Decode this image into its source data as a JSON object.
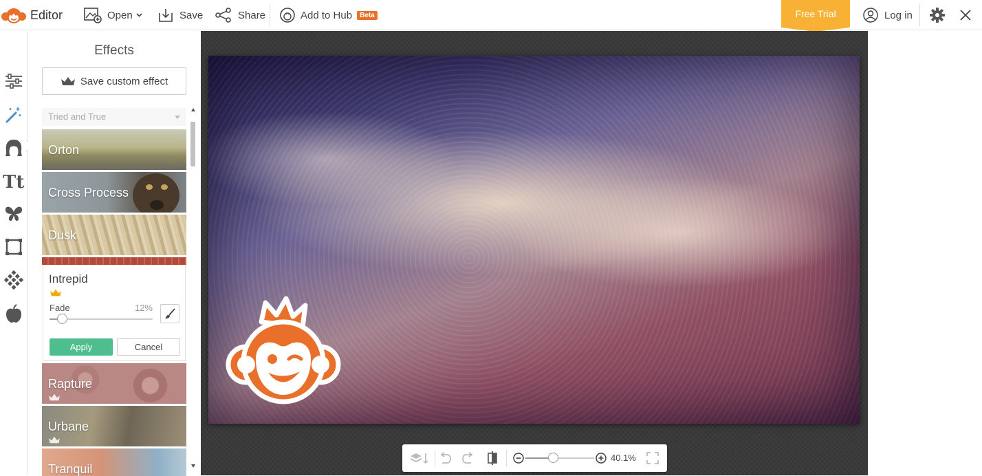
{
  "app": {
    "name": "Editor"
  },
  "colors": {
    "accent": "#e8702a",
    "apply": "#4fbe8e",
    "free_trial": "#f8b135"
  },
  "topbar": {
    "open_label": "Open",
    "save_label": "Save",
    "share_label": "Share",
    "hub_label": "Add to Hub",
    "beta_badge": "Beta",
    "free_trial_label": "Free Trial",
    "login_label": "Log in"
  },
  "rail": {
    "icons": [
      "sliders-icon",
      "magic-wand-icon",
      "hair-icon",
      "text-icon",
      "butterfly-icon",
      "frame-icon",
      "texture-icon",
      "apple-icon"
    ],
    "active_index": 1
  },
  "effects": {
    "title": "Effects",
    "save_custom_label": "Save custom effect",
    "category": "Tried and True",
    "items_top": [
      {
        "label": "Orton",
        "premium": false
      },
      {
        "label": "Cross Process",
        "premium": false
      },
      {
        "label": "Dusk",
        "premium": false
      }
    ],
    "selected": {
      "label": "Intrepid",
      "premium": true,
      "fade_label": "Fade",
      "fade_value": "12%",
      "fade_level": 0.12,
      "apply_label": "Apply",
      "cancel_label": "Cancel"
    },
    "items_bottom": [
      {
        "label": "Rapture",
        "premium": true
      },
      {
        "label": "Urbane",
        "premium": true
      },
      {
        "label": "Tranquil",
        "premium": false
      }
    ]
  },
  "zoom": {
    "value": "40.1%",
    "level": 0.4
  }
}
